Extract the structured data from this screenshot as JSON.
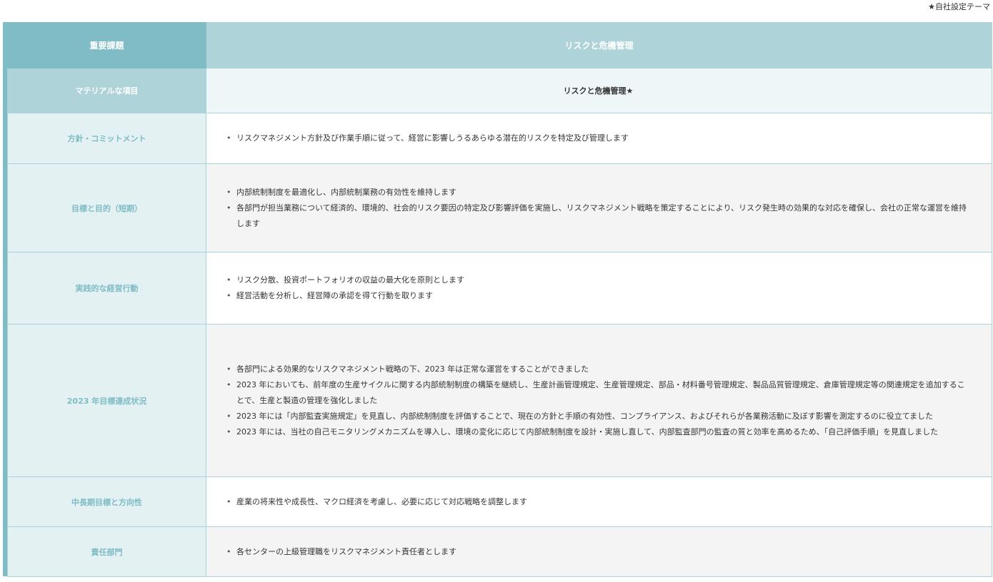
{
  "note": "★自社設定テーマ",
  "header": {
    "left": "重要課題",
    "right": "リスクと危機管理"
  },
  "material": {
    "label": "マテリアルな項目",
    "value": "リスクと危機管理★"
  },
  "rows": [
    {
      "label": "方針・コミットメント",
      "items": [
        "リスクマネジメント方針及び作業手順に従って、経営に影響しうるあらゆる潜在的リスクを特定及び管理します"
      ]
    },
    {
      "label": "目標と目的（短期）",
      "items": [
        "内部統制制度を最適化し、内部統制業務の有効性を維持します",
        "各部門が担当業務について経済的、環境的、社会的リスク要因の特定及び影響評価を実施し、リスクマネジメント戦略を策定することにより、リスク発生時の効果的な対応を確保し、会社の正常な運営を維持します"
      ]
    },
    {
      "label": "実践的な経営行動",
      "items": [
        "リスク分散、投資ポートフォリオの収益の最大化を原則とします",
        "経営活動を分析し、経営陣の承認を得て行動を取ります"
      ]
    },
    {
      "label": "2023 年目標達成状況",
      "items": [
        "各部門による効果的なリスクマネジメント戦略の下、2023 年は正常な運営をすることができました",
        "2023 年においても、前年度の生産サイクルに関する内部統制制度の構築を継続し、生産計画管理規定、生産管理規定、部品・材料番号管理規定、製品品質管理規定、倉庫管理規定等の関連規定を追加することで、生産と製造の管理を強化しました",
        "2023 年には「内部監査実施規定」を見直し、内部統制制度を評価することで、現在の方針と手順の有効性、コンプライアンス、およびそれらが各業務活動に及ぼす影響を測定するのに役立てました",
        "2023 年には、当社の自己モニタリングメカニズムを導入し、環境の変化に応じて内部統制制度を設計・実施し直して、内部監査部門の監査の質と効率を高めるため、「自己評価手順」を見直しました"
      ]
    },
    {
      "label": "中長期目標と方向性",
      "items": [
        "産業の将来性や成長性、マクロ経済を考慮し、必要に応じて対応戦略を調整します"
      ]
    },
    {
      "label": "責任部門",
      "items": [
        "各センターの上級管理職をリスクマネジメント責任者とします"
      ]
    }
  ]
}
